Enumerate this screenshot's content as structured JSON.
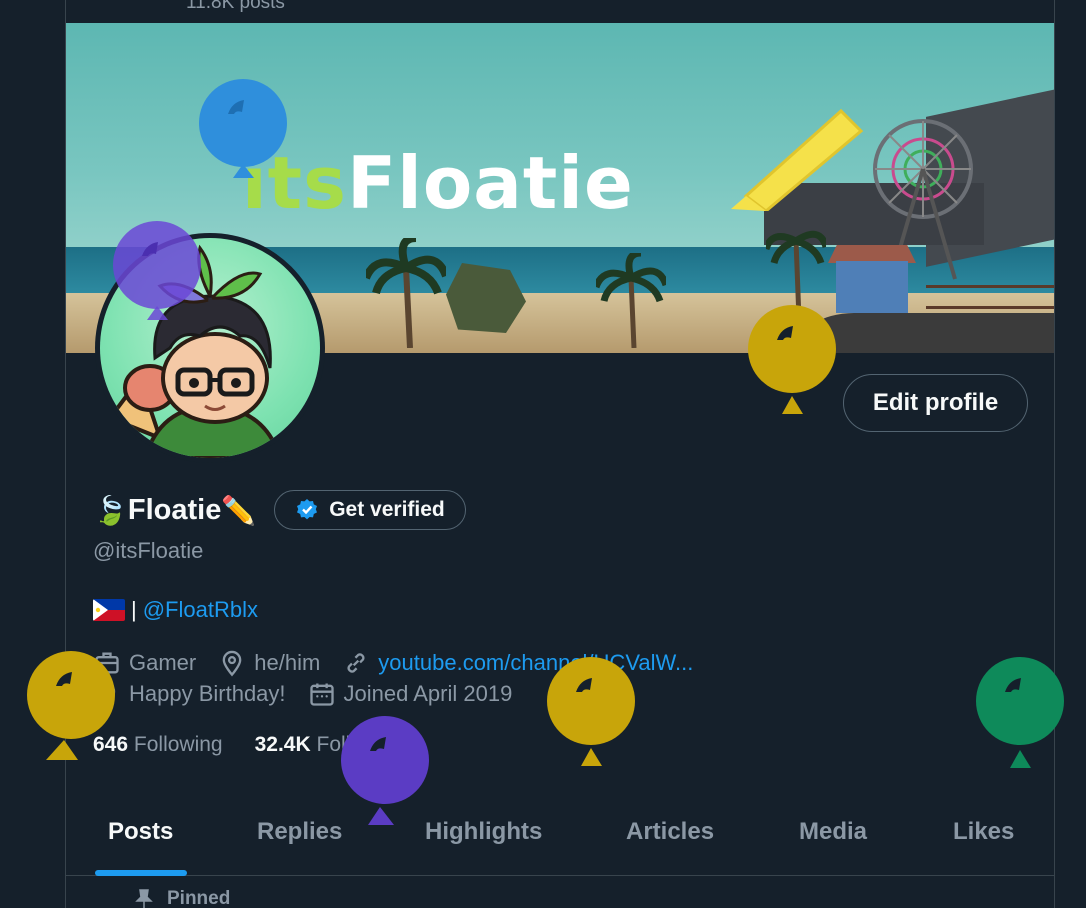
{
  "header": {
    "post_count": "11.8K posts"
  },
  "banner": {
    "logo_prefix": "its",
    "logo_main": "Floatie"
  },
  "profile": {
    "edit_label": "Edit profile",
    "display_name": "Floatie",
    "name_prefix_emoji": "🍃",
    "name_suffix_emoji": "✏️",
    "verify_label": "Get verified",
    "handle": "@itsFloatie",
    "bio_separator": "|",
    "bio_link": "@FloatRblx",
    "category": "Gamer",
    "location": "he/him",
    "website": "youtube.com/channel/UCValW...",
    "birthday": "Happy Birthday!",
    "joined": "Joined April 2019",
    "following_count": "646",
    "following_label": "Following",
    "followers_count": "32.4K",
    "followers_label": "Followers"
  },
  "tabs": [
    "Posts",
    "Replies",
    "Highlights",
    "Articles",
    "Media",
    "Likes"
  ],
  "pinned_label": "Pinned",
  "colors": {
    "background": "#15202b",
    "accent": "#1d9bf0",
    "muted": "#8b98a5"
  },
  "icons": [
    "briefcase-icon",
    "location-pin-icon",
    "link-icon",
    "balloon-icon",
    "calendar-icon",
    "verified-badge-icon",
    "pin-icon"
  ]
}
